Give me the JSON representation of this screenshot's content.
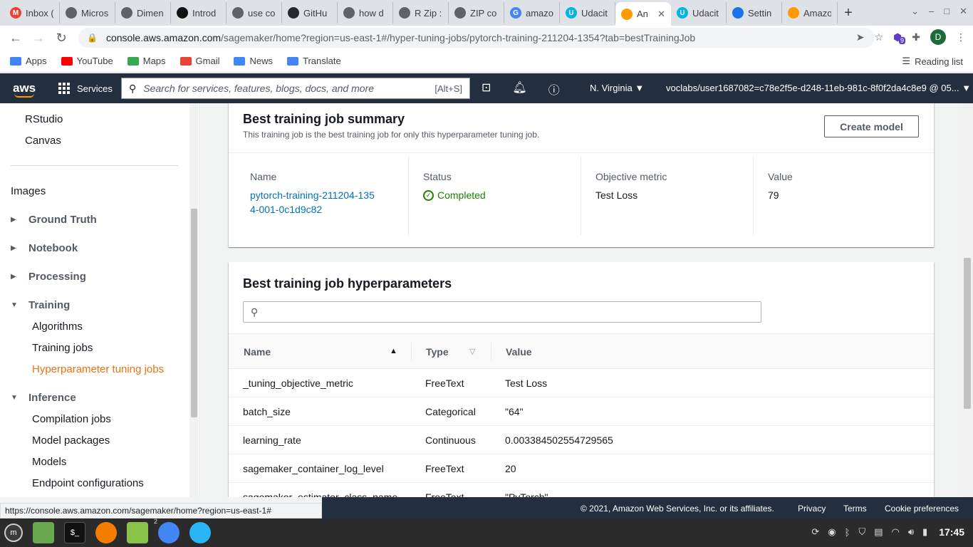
{
  "browser": {
    "tabs": [
      {
        "label": "Inbox (",
        "color": "#ea4335",
        "glyph": "M"
      },
      {
        "label": "Micros",
        "color": "#5f6368",
        "glyph": ""
      },
      {
        "label": "Dimen",
        "color": "#5f6368",
        "glyph": ""
      },
      {
        "label": "Introd",
        "color": "#111111",
        "glyph": ""
      },
      {
        "label": "use co",
        "color": "#5f6368",
        "glyph": ""
      },
      {
        "label": "GitHu",
        "color": "#24292e",
        "glyph": ""
      },
      {
        "label": "how d",
        "color": "#5f6368",
        "glyph": ""
      },
      {
        "label": "R Zip :",
        "color": "#5f6368",
        "glyph": ""
      },
      {
        "label": "ZIP co",
        "color": "#5f6368",
        "glyph": ""
      },
      {
        "label": "amazo",
        "color": "#4285f4",
        "glyph": "G"
      },
      {
        "label": "Udacit",
        "color": "#02b3e4",
        "glyph": "U"
      },
      {
        "label": "An",
        "color": "#ff9900",
        "glyph": ""
      },
      {
        "label": "Udacit",
        "color": "#02b3e4",
        "glyph": "U"
      },
      {
        "label": "Settin",
        "color": "#1a73e8",
        "glyph": ""
      },
      {
        "label": "Amazo",
        "color": "#ff9900",
        "glyph": ""
      }
    ],
    "url_host": "console.aws.amazon.com",
    "url_path": "/sagemaker/home?region=us-east-1#/hyper-tuning-jobs/pytorch-training-211204-1354?tab=bestTrainingJob",
    "profile_initial": "D",
    "extension_badge": "9",
    "bookmarks": [
      {
        "label": "Apps",
        "color": "#4285f4"
      },
      {
        "label": "YouTube",
        "color": "#ff0000"
      },
      {
        "label": "Maps",
        "color": "#34a853"
      },
      {
        "label": "Gmail",
        "color": "#ea4335"
      },
      {
        "label": "News",
        "color": "#4285f4"
      },
      {
        "label": "Translate",
        "color": "#4285f4"
      }
    ],
    "reading_list": "Reading list",
    "status_url": "https://console.aws.amazon.com/sagemaker/home?region=us-east-1#"
  },
  "aws_nav": {
    "logo": "aws",
    "services": "Services",
    "search_placeholder": "Search for services, features, blogs, docs, and more",
    "search_shortcut": "[Alt+S]",
    "region": "N. Virginia",
    "account": "voclabs/user1687082=c78e2f5e-d248-11eb-981c-8f0f2da4c8e9 @ 05..."
  },
  "sidebar": {
    "top_items": [
      "RStudio",
      "Canvas"
    ],
    "images": "Images",
    "collapsed_sections": [
      "Ground Truth",
      "Notebook",
      "Processing"
    ],
    "training": {
      "label": "Training",
      "items": [
        "Algorithms",
        "Training jobs",
        "Hyperparameter tuning jobs"
      ]
    },
    "inference": {
      "label": "Inference",
      "items": [
        "Compilation jobs",
        "Model packages",
        "Models",
        "Endpoint configurations"
      ]
    }
  },
  "summary": {
    "title": "Best training job summary",
    "description": "This training job is the best training job for only this hyperparameter tuning job.",
    "create_model": "Create model",
    "name_label": "Name",
    "name_value": "pytorch-training-211204-1354-001-0c1d9c82",
    "status_label": "Status",
    "status_value": "Completed",
    "metric_label": "Objective metric",
    "metric_value": "Test Loss",
    "value_label": "Value",
    "value_value": "79"
  },
  "hyperparameters": {
    "title": "Best training job hyperparameters",
    "columns": {
      "name": "Name",
      "type": "Type",
      "value": "Value"
    },
    "rows": [
      {
        "name": "_tuning_objective_metric",
        "type": "FreeText",
        "value": "Test Loss"
      },
      {
        "name": "batch_size",
        "type": "Categorical",
        "value": "\"64\""
      },
      {
        "name": "learning_rate",
        "type": "Continuous",
        "value": "0.003384502554729565"
      },
      {
        "name": "sagemaker_container_log_level",
        "type": "FreeText",
        "value": "20"
      },
      {
        "name": "sagemaker_estimator_class_name",
        "type": "FreeText",
        "value": "\"PyTorch\""
      }
    ]
  },
  "footer": {
    "copyright": "© 2021, Amazon Web Services, Inc. or its affiliates.",
    "privacy": "Privacy",
    "terms": "Terms",
    "cookies": "Cookie preferences"
  },
  "taskbar": {
    "clock": "17:45",
    "terminal_label": "$_",
    "chrome_badge": "2"
  }
}
